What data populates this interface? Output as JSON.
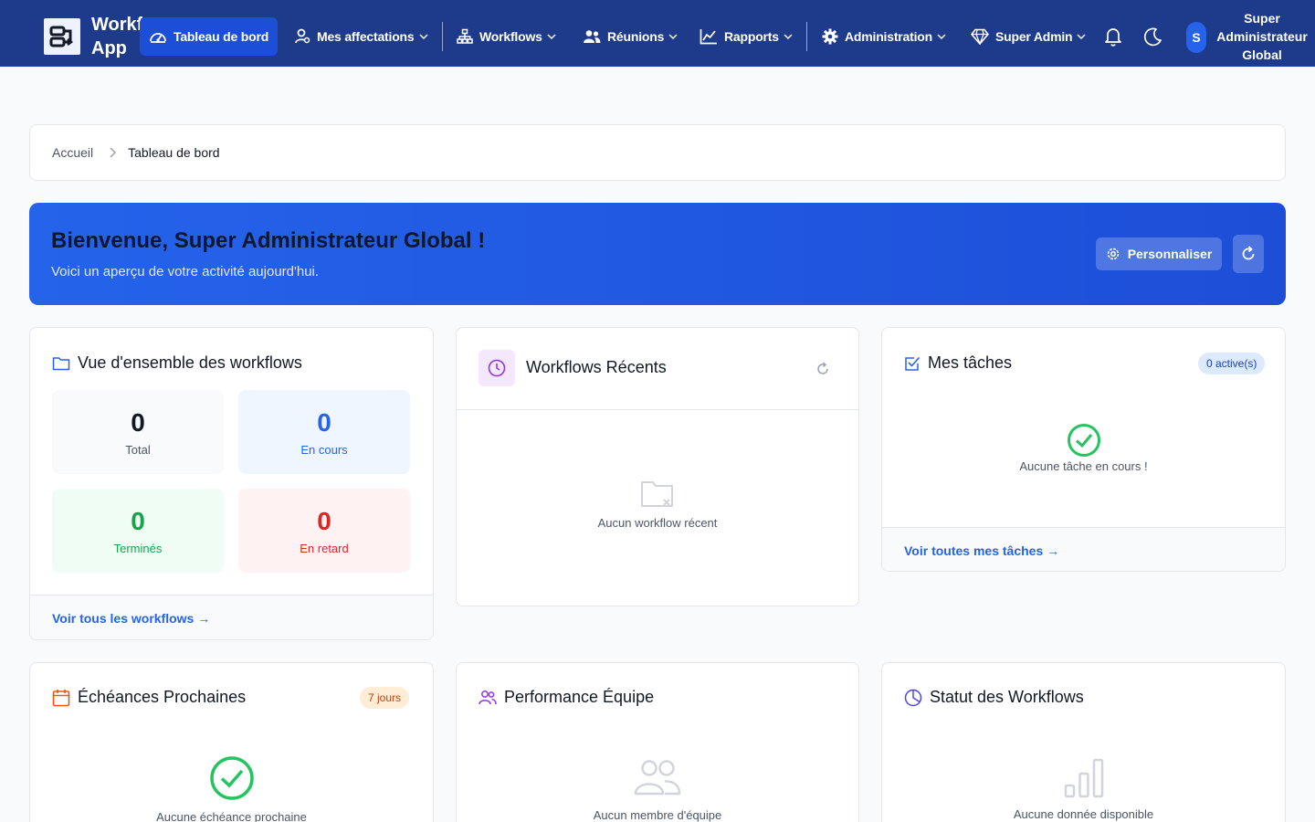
{
  "nav": {
    "logo_text": "Workflow App",
    "items": [
      {
        "label": "Tableau de bord",
        "icon": "dashboard-gauge-icon"
      },
      {
        "label": "Mes affectations",
        "icon": "user-assign-icon"
      },
      {
        "label": "Workflows",
        "icon": "workflow-tree-icon"
      },
      {
        "label": "Réunions",
        "icon": "users-meeting-icon"
      },
      {
        "label": "Rapports",
        "icon": "chart-line-icon"
      },
      {
        "label": "Administration",
        "icon": "gear-icon"
      },
      {
        "label": "Super Admin",
        "icon": "diamond-icon"
      }
    ],
    "avatar_initial": "S",
    "user_name": "Super Administrateur Global"
  },
  "breadcrumb": {
    "home": "Accueil",
    "current": "Tableau de bord"
  },
  "welcome": {
    "title": "Bienvenue, Super Administrateur Global !",
    "subtitle": "Voici un aperçu de votre activité aujourd'hui.",
    "customize_label": "Personnaliser"
  },
  "overview": {
    "title": "Vue d'ensemble des workflows",
    "stats": [
      {
        "value": "0",
        "label": "Total"
      },
      {
        "value": "0",
        "label": "En cours"
      },
      {
        "value": "0",
        "label": "Terminés"
      },
      {
        "value": "0",
        "label": "En retard"
      }
    ],
    "footer_link": "Voir tous les workflows →"
  },
  "recent": {
    "title": "Workflows Récents",
    "empty_text": "Aucun workflow récent"
  },
  "tasks": {
    "title": "Mes tâches",
    "badge": "0 active(s)",
    "empty_text": "Aucune tâche en cours !",
    "footer_link": "Voir toutes mes tâches →"
  },
  "deadlines": {
    "title": "Échéances Prochaines",
    "badge": "7 jours",
    "empty_text": "Aucune échéance prochaine"
  },
  "team": {
    "title": "Performance Équipe",
    "empty_text": "Aucun membre d'équipe"
  },
  "status": {
    "title": "Statut des Workflows",
    "empty_text": "Aucune donnée disponible"
  },
  "colors": {
    "nav_bg": "#1e3a8a",
    "primary": "#2563eb",
    "success": "#16a34a",
    "danger": "#dc2626",
    "accent_purple": "#9333ea",
    "accent_orange": "#ea580c"
  }
}
